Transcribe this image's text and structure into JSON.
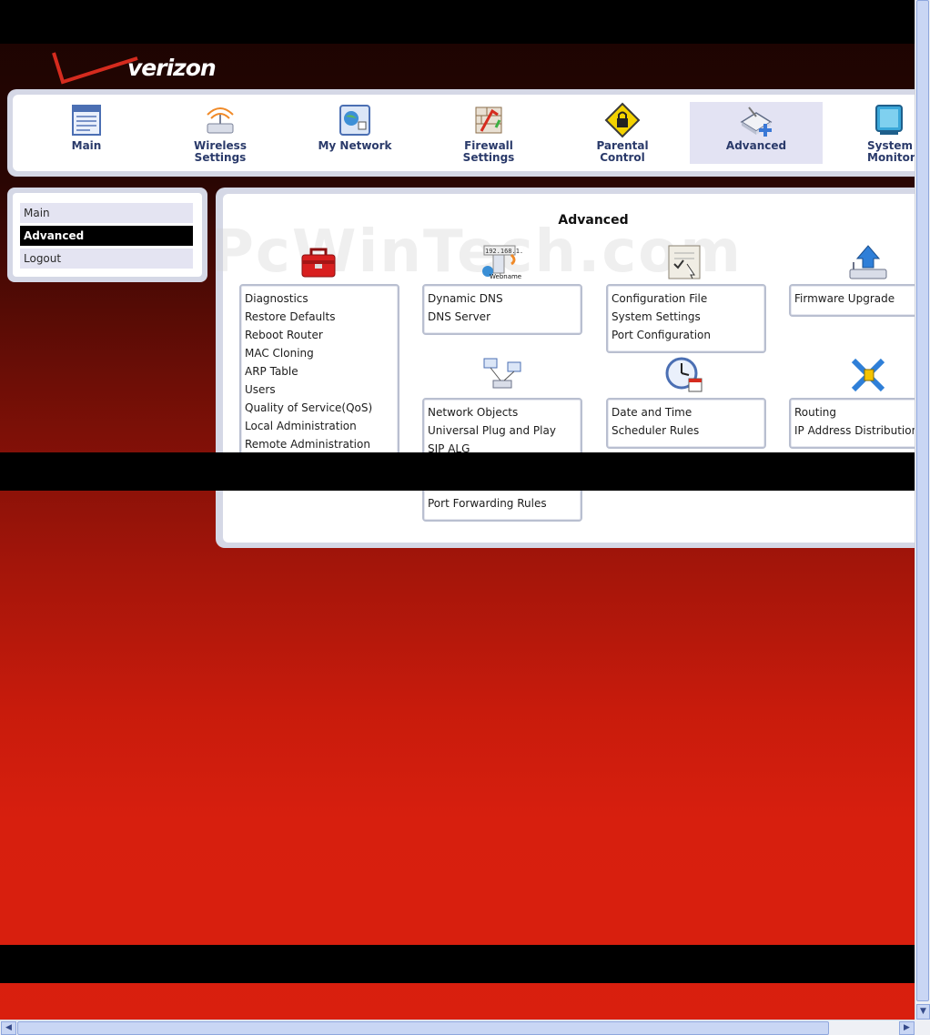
{
  "brand": {
    "logo_text": "verizon",
    "logo_color": "#d52b1e"
  },
  "nav": {
    "items": [
      {
        "label": "Main",
        "icon": "main-icon"
      },
      {
        "label": "Wireless\nSettings",
        "icon": "wireless-icon"
      },
      {
        "label": "My Network",
        "icon": "network-icon"
      },
      {
        "label": "Firewall\nSettings",
        "icon": "firewall-icon"
      },
      {
        "label": "Parental\nControl",
        "icon": "lock-icon"
      },
      {
        "label": "Advanced",
        "icon": "advanced-icon",
        "active": true
      },
      {
        "label": "System\nMonitoring",
        "icon": "monitor-icon"
      }
    ]
  },
  "sidebar": {
    "items": [
      {
        "label": "Main"
      },
      {
        "label": "Advanced",
        "active": true
      },
      {
        "label": "Logout"
      }
    ]
  },
  "content": {
    "title": "Advanced",
    "watermark": "PcWinTech.com",
    "groups": [
      {
        "icon": "toolbox-icon",
        "links": [
          "Diagnostics",
          "Restore Defaults",
          "Reboot Router",
          "MAC Cloning",
          "ARP Table",
          "Users",
          "Quality of Service(QoS)",
          "Local Administration",
          "Remote Administration"
        ]
      },
      {
        "icon": "dns-icon",
        "icon_text": "192.168.1.1",
        "icon_text2": "Webname",
        "links": [
          "Dynamic DNS",
          "DNS Server"
        ]
      },
      {
        "icon": "config-icon",
        "links": [
          "Configuration File",
          "System Settings",
          "Port Configuration"
        ]
      },
      {
        "icon": "firmware-icon",
        "links": [
          "Firmware Upgrade"
        ]
      },
      {
        "icon": "network-objects-icon",
        "links": [
          "Network Objects",
          "Universal Plug and Play",
          "SIP ALG",
          "Port Forwarding Rules"
        ]
      },
      {
        "icon": "clock-icon",
        "links": [
          "Date and Time",
          "Scheduler Rules"
        ]
      },
      {
        "icon": "routing-icon",
        "links": [
          "Routing",
          "IP Address Distribution"
        ]
      }
    ]
  },
  "colors": {
    "accent": "#2a3a6a",
    "frame": "#d5d8e6",
    "active_bg": "#000000"
  }
}
